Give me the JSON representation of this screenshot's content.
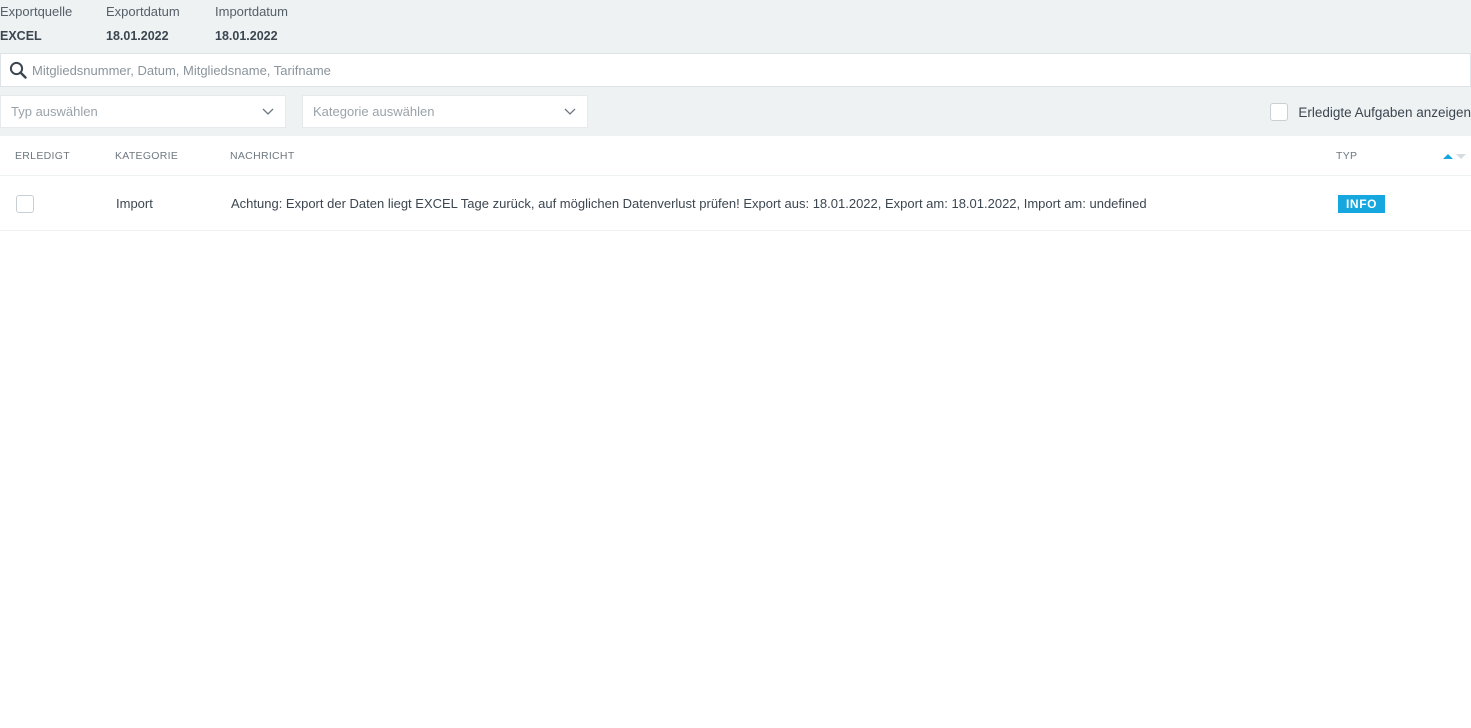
{
  "meta": {
    "source_label": "Exportquelle",
    "source_value": "EXCEL",
    "export_label": "Exportdatum",
    "export_value": "18.01.2022",
    "import_label": "Importdatum",
    "import_value": "18.01.2022"
  },
  "search": {
    "placeholder": "Mitgliedsnummer, Datum, Mitgliedsname, Tarifname",
    "icon": "search-icon"
  },
  "filters": {
    "type_placeholder": "Typ auswählen",
    "category_placeholder": "Kategorie auswählen",
    "show_done_label": "Erledigte Aufgaben anzeigen",
    "show_done_checked": false
  },
  "table": {
    "headers": {
      "done": "ERLEDIGT",
      "category": "KATEGORIE",
      "message": "NACHRICHT",
      "type": "TYP"
    },
    "sort": "ascending",
    "rows": [
      {
        "done": false,
        "category": "Import",
        "message": "Achtung: Export der Daten liegt EXCEL Tage zurück, auf möglichen Datenverlust prüfen! Export aus: 18.01.2022, Export am: 18.01.2022, Import am: undefined",
        "type": "INFO"
      }
    ]
  },
  "colors": {
    "background_top": "#eef2f3",
    "badge_info": "#15a7de",
    "sort_active": "#15a7de"
  }
}
